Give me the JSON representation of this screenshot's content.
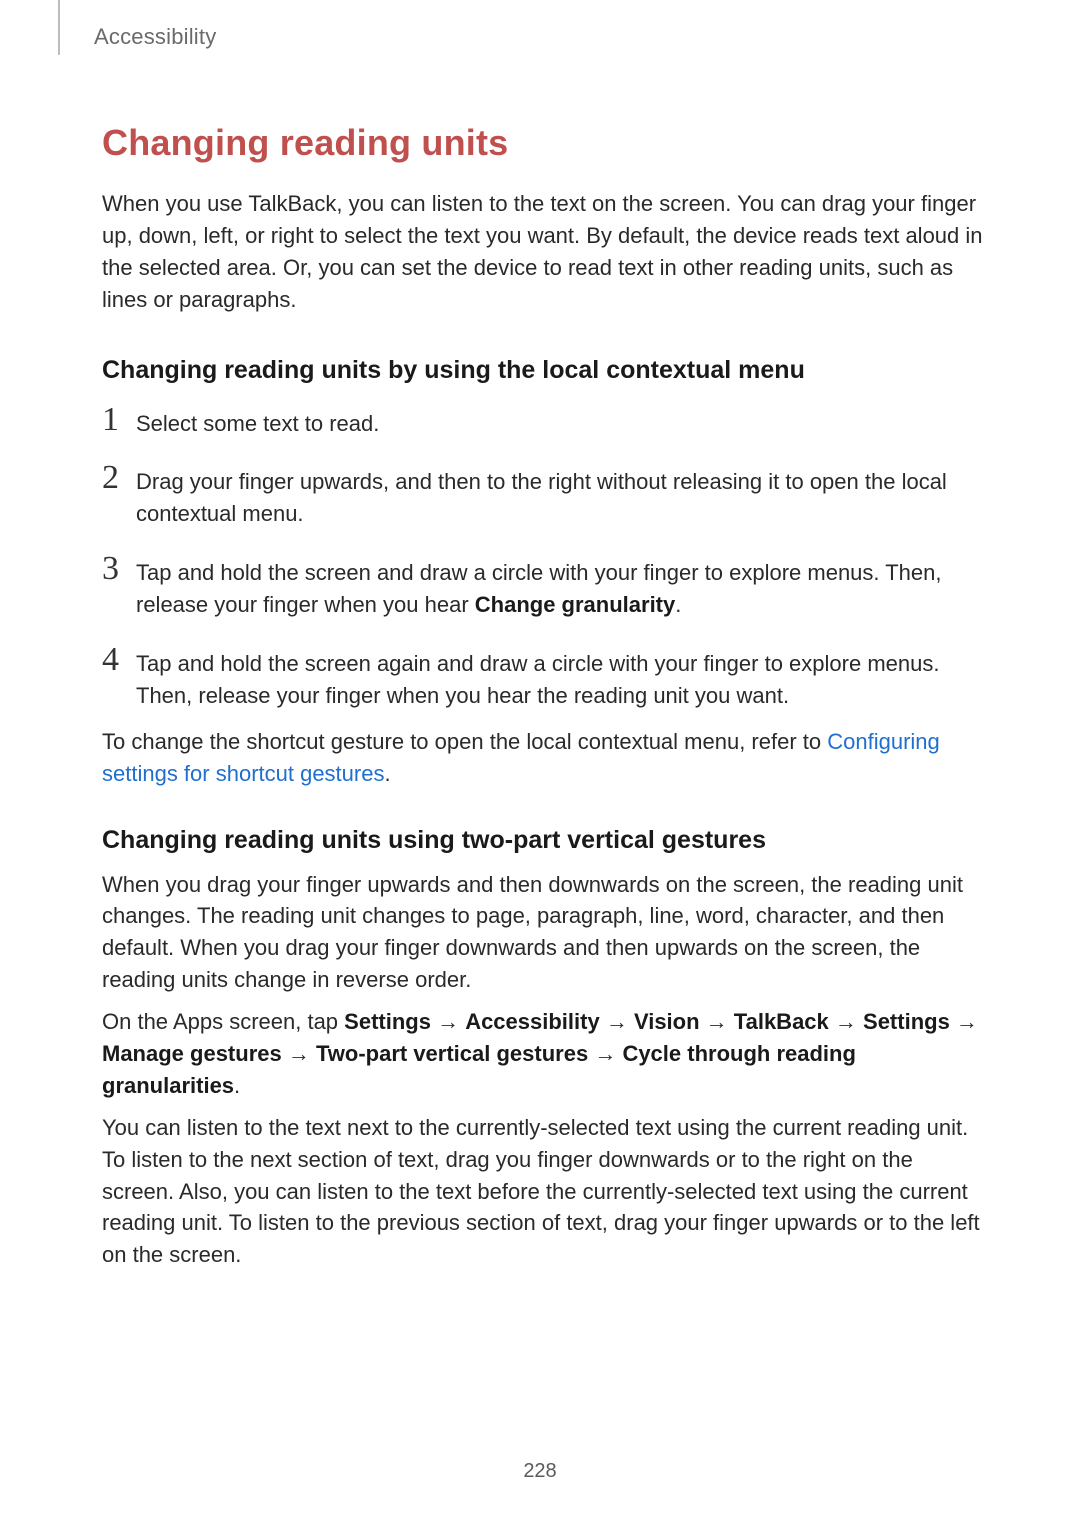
{
  "header": {
    "section": "Accessibility"
  },
  "h1": "Changing reading units",
  "intro": "When you use TalkBack, you can listen to the text on the screen. You can drag your finger up, down, left, or right to select the text you want. By default, the device reads text aloud in the selected area. Or, you can set the device to read text in other reading units, such as lines or paragraphs.",
  "h2a": "Changing reading units by using the local contextual menu",
  "steps": {
    "n1": "1",
    "t1": "Select some text to read.",
    "n2": "2",
    "t2": "Drag your finger upwards, and then to the right without releasing it to open the local contextual menu.",
    "n3": "3",
    "t3a": "Tap and hold the screen and draw a circle with your finger to explore menus. Then, release your finger when you hear ",
    "t3b": "Change granularity",
    "t3c": ".",
    "n4": "4",
    "t4": "Tap and hold the screen again and draw a circle with your finger to explore menus. Then, release your finger when you hear the reading unit you want."
  },
  "followup": {
    "a": "To change the shortcut gesture to open the local contextual menu, refer to ",
    "link": "Configuring settings for shortcut gestures",
    "c": "."
  },
  "h2b": "Changing reading units using two-part vertical gestures",
  "p1": "When you drag your finger upwards and then downwards on the screen, the reading unit changes. The reading unit changes to page, paragraph, line, word, character, and then default. When you drag your finger downwards and then upwards on the screen, the reading units change in reverse order.",
  "p2": {
    "a": "On the Apps screen, tap ",
    "b1": "Settings",
    "ar1": " → ",
    "b2": "Accessibility",
    "ar2": " → ",
    "b3": "Vision",
    "ar3": " → ",
    "b4": "TalkBack",
    "ar4": " → ",
    "b5": "Settings",
    "ar5": " → ",
    "b6": "Manage gestures",
    "ar6": " → ",
    "b7": "Two-part vertical gestures",
    "ar7": " → ",
    "b8": "Cycle through reading granularities",
    "end": "."
  },
  "p3": "You can listen to the text next to the currently-selected text using the current reading unit. To listen to the next section of text, drag you finger downwards or to the right on the screen. Also, you can listen to the text before the currently-selected text using the current reading unit. To listen to the previous section of text, drag your finger upwards or to the left on the screen.",
  "pagenum": "228"
}
